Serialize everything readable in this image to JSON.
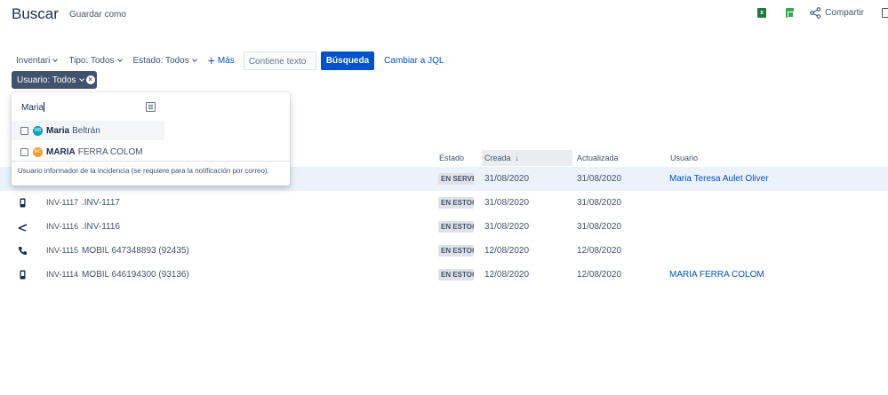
{
  "header": {
    "title": "Buscar",
    "save_as": "Guardar como",
    "share": "Compartir"
  },
  "filters": {
    "project": "Inventari",
    "type": "Tipo: Todos",
    "status": "Estado: Todos",
    "more": "Más",
    "text_placeholder": "Contiene texto",
    "search_button": "Búsqueda",
    "switch_jql": "Cambiar a JQL",
    "user_filter": "Usuario: Todos"
  },
  "user_dropdown": {
    "query": "Maria",
    "options": [
      {
        "bold": "Maria",
        "rest": "Beltrán",
        "initials": "MB",
        "color": "#00a3bf",
        "checked": false
      },
      {
        "bold": "MARIA",
        "rest": "FERRA COLOM",
        "initials": "MC",
        "color": "#ff991f",
        "checked": false
      }
    ],
    "hint": "Usuario informador de la incidencia (se requiere para la notificación por correo)."
  },
  "table": {
    "columns": {
      "estado": "Estado",
      "creada": "Creada",
      "actualizada": "Actualizada",
      "usuario": "Usuario"
    },
    "rows": [
      {
        "icon": "laptop-icon",
        "key": "",
        "summary": "",
        "status": "EN SERVEI",
        "created": "31/08/2020",
        "updated": "31/08/2020",
        "user": "Maria Teresa Aulet Oliver",
        "selected": true
      },
      {
        "icon": "phone-device-icon",
        "key": "INV-1117",
        "summary": ".INV-1117",
        "status": "EN ESTOC",
        "created": "31/08/2020",
        "updated": "31/08/2020",
        "user": ""
      },
      {
        "icon": "pen-icon",
        "key": "INV-1116",
        "summary": ".INV-1116",
        "status": "EN ESTOC",
        "created": "31/08/2020",
        "updated": "31/08/2020",
        "user": ""
      },
      {
        "icon": "telephone-icon",
        "key": "INV-1115",
        "summary": "MOBIL 647348893 (92435)",
        "status": "EN ESTOC",
        "created": "12/08/2020",
        "updated": "12/08/2020",
        "user": ""
      },
      {
        "icon": "phone-device-icon",
        "key": "INV-1114",
        "summary": "MOBIL 646194300 (93136)",
        "status": "EN ESTOC",
        "created": "12/08/2020",
        "updated": "12/08/2020",
        "user": "MARIA FERRA COLOM"
      }
    ]
  }
}
